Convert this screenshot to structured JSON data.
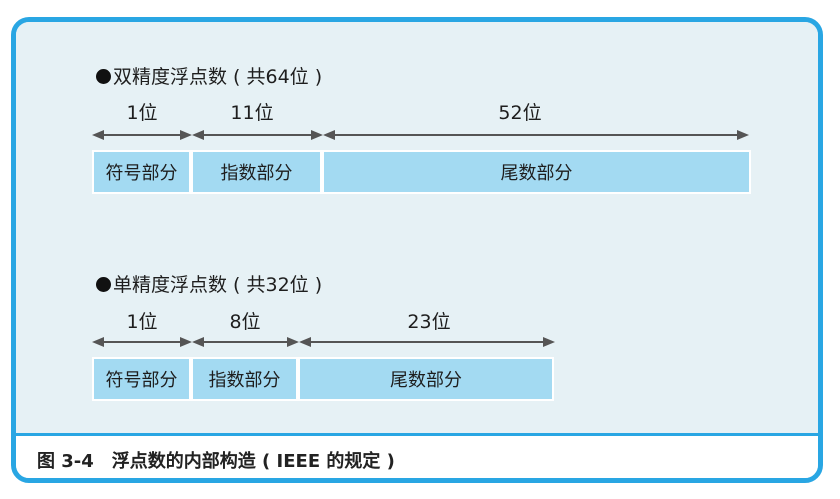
{
  "figure": {
    "caption": "图 3-4　浮点数的内部构造 ( IEEE 的规定 )",
    "colors": {
      "frame": "#29a6e3",
      "panel": "#e6f1f5",
      "box_fill": "#a3daf2",
      "arrow": "#555555"
    }
  },
  "double": {
    "title": "双精度浮点数 ( 共64位 )",
    "widths": [
      "1位",
      "11位",
      "52位"
    ],
    "fields": [
      "符号部分",
      "指数部分",
      "尾数部分"
    ]
  },
  "single": {
    "title": "单精度浮点数 ( 共32位 )",
    "widths": [
      "1位",
      "8位",
      "23位"
    ],
    "fields": [
      "符号部分",
      "指数部分",
      "尾数部分"
    ]
  }
}
